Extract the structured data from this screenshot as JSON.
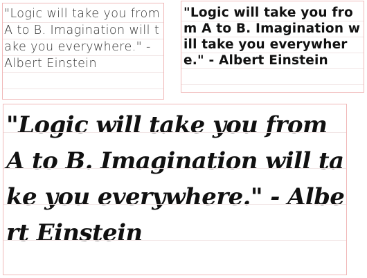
{
  "samples": [
    {
      "style": "thin-rounded-sans",
      "text": "\"Logic will take you from A to B. Imagination will take you everywhere.\" - Albert Einstein"
    },
    {
      "style": "bold-geometric-sans",
      "text": "\"Logic will take you from A to B. Imagination will take you everywhere.\" - Albert Einstein"
    },
    {
      "style": "bold-script",
      "text": "\"Logic will take you from A to B. Imagination will take you everywhere.\" - Albert Einstein"
    }
  ],
  "colors": {
    "box_border": "#f0b8b8",
    "guide_line": "#f1e4e4",
    "text": "#111111",
    "background": "#ffffff"
  }
}
